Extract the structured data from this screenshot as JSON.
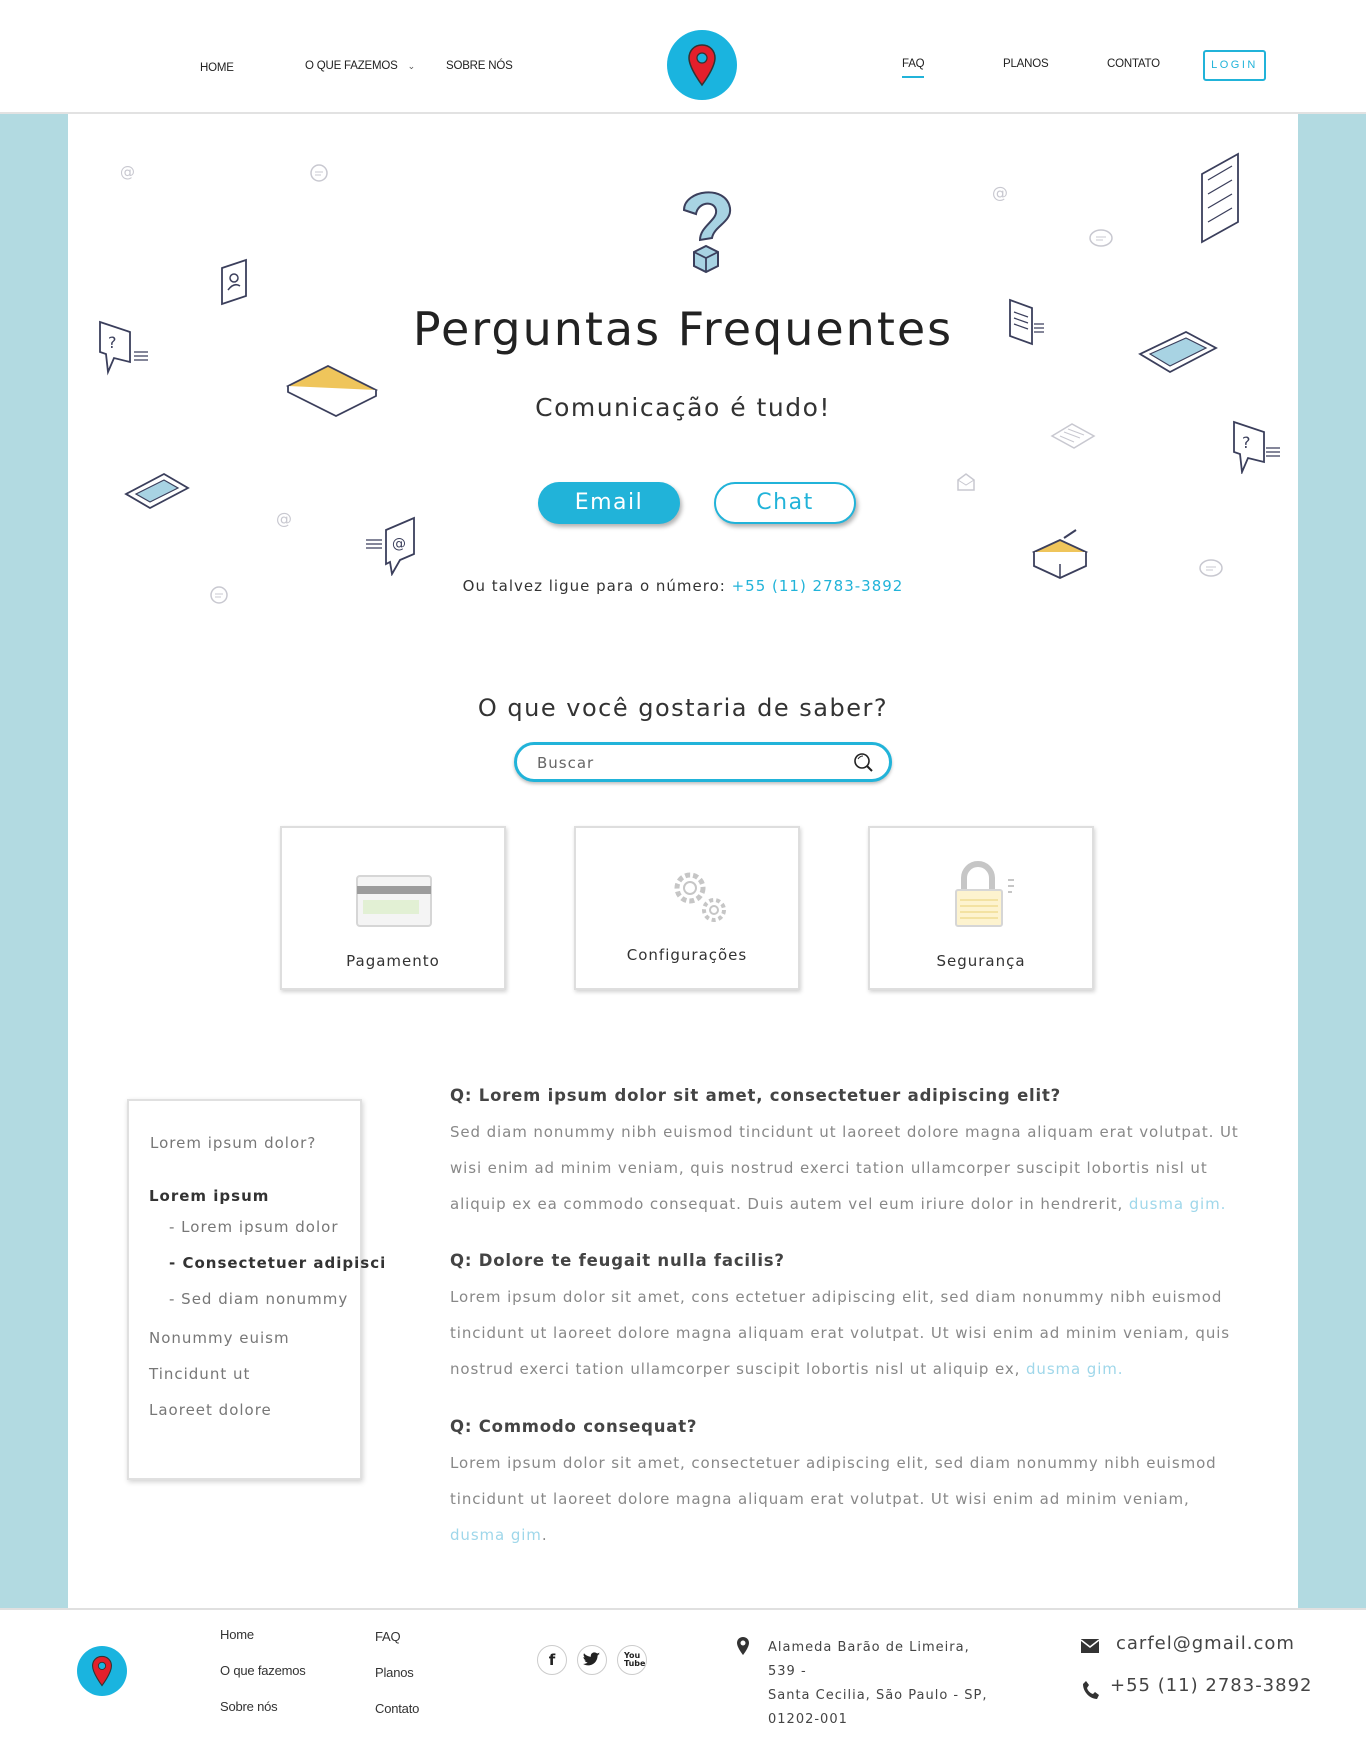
{
  "colors": {
    "accent": "#21b3d9",
    "logo_bg": "#1ab4df",
    "pin": "#e3202b",
    "side_band": "#b2dae1",
    "link_light": "#9fd7ea"
  },
  "header": {
    "nav_left": [
      {
        "label": "HOME"
      },
      {
        "label": "O QUE FAZEMOS",
        "icon": "chevron-down-icon"
      },
      {
        "label": "SOBRE NÓS"
      }
    ],
    "logo_icon": "map-pin-icon",
    "nav_right": [
      {
        "label": "FAQ",
        "active": true
      },
      {
        "label": "PLANOS"
      },
      {
        "label": "CONTATO"
      }
    ],
    "login_label": "LOGIN"
  },
  "hero": {
    "icon": "question-mark-icon",
    "title": "Perguntas Frequentes",
    "subtitle": "Comunicação é tudo!",
    "email_label": "Email",
    "chat_label": "Chat",
    "phone_prefix": "Ou talvez ligue para o número: ",
    "phone_number": "+55 (11) 2783-3892"
  },
  "search": {
    "title": "O que você gostaria de saber?",
    "placeholder": "Buscar",
    "value": ""
  },
  "categories": [
    {
      "label": "Pagamento",
      "icon": "credit-card-icon"
    },
    {
      "label": "Configurações",
      "icon": "gears-icon"
    },
    {
      "label": "Segurança",
      "icon": "padlock-icon"
    }
  ],
  "side_menu": {
    "items": [
      {
        "label": "Lorem ipsum dolor?"
      },
      {
        "label": "Lorem ipsum"
      },
      {
        "label": "- Lorem ipsum dolor"
      },
      {
        "label": "- Consectetuer adipisci"
      },
      {
        "label": "- Sed diam nonummy"
      },
      {
        "label": "Nonummy euism"
      },
      {
        "label": "Tincidunt ut"
      },
      {
        "label": "Laoreet dolore"
      }
    ]
  },
  "faq": [
    {
      "question": "Q: Lorem ipsum dolor sit amet, consectetuer adipiscing elit?",
      "answer": "Sed diam nonummy nibh euismod tincidunt ut laoreet dolore magna aliquam erat volutpat. Ut wisi enim ad minim veniam, quis nostrud exerci tation ullamcorper suscipit lobortis nisl ut aliquip ex ea commodo consequat. Duis autem vel eum iriure dolor in hendrerit, ",
      "link": "dusma gim."
    },
    {
      "question": "Q: Dolore te feugait nulla facilis?",
      "answer": "Lorem ipsum dolor sit amet, cons ectetuer adipiscing elit, sed diam nonummy nibh euismod tincidunt ut laoreet dolore magna aliquam erat volutpat. Ut wisi enim ad minim veniam, quis nostrud exerci tation ullamcorper suscipit lobortis nisl ut aliquip ex, ",
      "link": "dusma gim."
    },
    {
      "question": "Q: Commodo consequat?",
      "answer": "Lorem ipsum dolor sit amet, consectetuer adipiscing elit, sed diam nonummy nibh euismod tincidunt ut laoreet dolore magna aliquam erat volutpat. Ut wisi enim ad minim veniam, ",
      "link": "dusma gim",
      "after": "."
    }
  ],
  "footer": {
    "logo_icon": "map-pin-icon",
    "col1": [
      "Home",
      "O que fazemos",
      "Sobre nós"
    ],
    "col2": [
      "FAQ",
      "Planos",
      "Contato"
    ],
    "social": [
      {
        "label": "f",
        "icon": "facebook-icon"
      },
      {
        "label": "",
        "icon": "twitter-icon"
      },
      {
        "label": "You Tube",
        "icon": "youtube-icon"
      }
    ],
    "address_lines": [
      "Alameda Barão de Limeira, 539 -",
      "Santa Cecilia, São Paulo - SP,",
      "01202-001"
    ],
    "email": "carfel@gmail.com",
    "phone": "+55 (11) 2783-3892"
  }
}
